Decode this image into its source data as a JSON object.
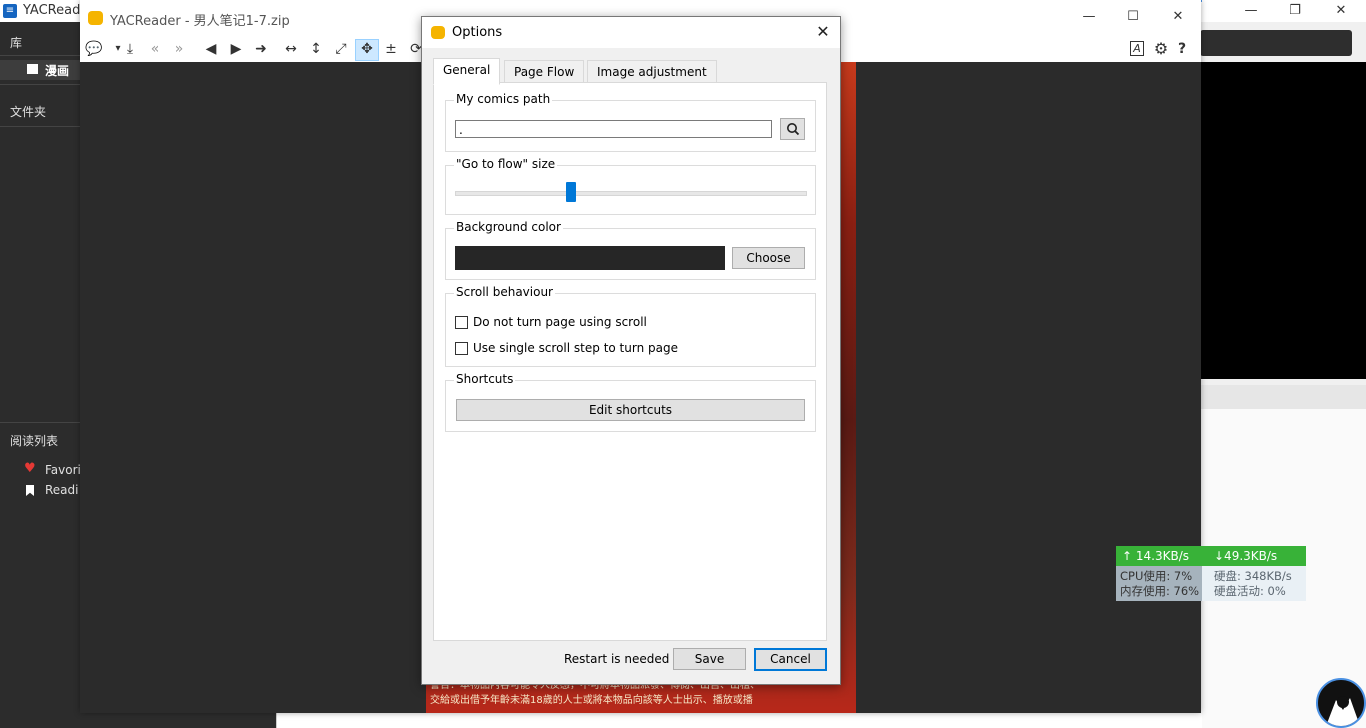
{
  "library": {
    "window_title": "YACReader",
    "icons": {
      "app": "yacreader-library-icon",
      "minimize": "minimize-icon",
      "maximize": "restore-icon",
      "close": "close-icon"
    },
    "sidebar": {
      "section_library": "库",
      "comics_item": "漫画",
      "folders": "文件夹",
      "reading_lists": "阅读列表",
      "favorites": "Favori",
      "reading": "Readi"
    }
  },
  "reader": {
    "window_title": "YACReader - 男人笔记1-7.zip",
    "comic_footer_line1": "警告：本物品內容可能令人反感，不可將本物品派發、傳閱、出售、出租、",
    "comic_footer_line2": "交給或出借予年齡未滿18歲的人士或將本物品向該等人士出示、播放或播",
    "toolbar_icons": [
      "speech-bubble-icon",
      "save-icon",
      "previous-comic-icon",
      "next-comic-icon",
      "previous-page-icon",
      "next-page-icon",
      "goto-page-icon",
      "fit-width-icon",
      "fit-height-icon",
      "fullscreen-icon",
      "fit-page-icon",
      "double-page-icon",
      "rotate-icon"
    ],
    "right_icons": [
      "font-icon",
      "gear-icon",
      "help-icon"
    ]
  },
  "options_dialog": {
    "title": "Options",
    "tabs": [
      {
        "label": "General",
        "selected": true
      },
      {
        "label": "Page Flow",
        "selected": false
      },
      {
        "label": "Image adjustment",
        "selected": false
      }
    ],
    "my_comics_path": {
      "title": "My comics path",
      "value": "."
    },
    "goto_flow_size": {
      "title": "\"Go to flow\" size",
      "value_fraction": 0.33
    },
    "background_color": {
      "title": "Background color",
      "color": "#262626",
      "choose_label": "Choose"
    },
    "scroll_behaviour": {
      "title": "Scroll behaviour",
      "option1": "Do not turn page using scroll",
      "option2": "Use single scroll step to turn page"
    },
    "shortcuts": {
      "title": "Shortcuts",
      "edit_label": "Edit shortcuts"
    },
    "footer": {
      "restart_note": "Restart is needed",
      "save": "Save",
      "cancel": "Cancel"
    }
  },
  "netmon": {
    "upload": "↑ 14.3KB/s",
    "download": "↓49.3KB/s",
    "cpu": "CPU使用: 7%",
    "mem": "内存使用: 76%",
    "disk": "硬盘: 348KB/s",
    "disk_activity": "硬盘活动: 0%"
  },
  "colors": {
    "accent": "#0078d7",
    "netmon_green": "#38b238",
    "comic_red": "#c73a1c"
  }
}
